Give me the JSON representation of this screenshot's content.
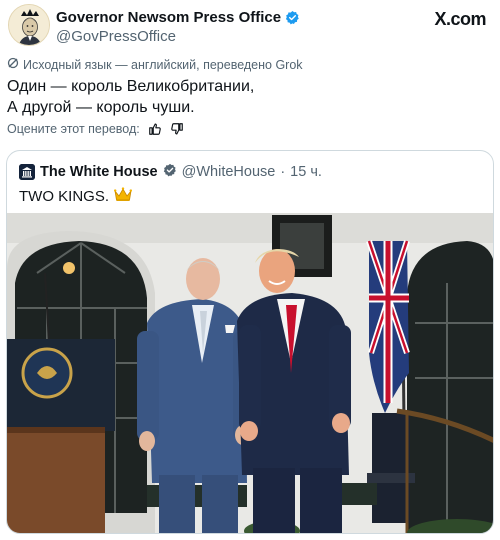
{
  "post": {
    "author_name": "Governor Newsom Press Office",
    "author_handle": "@GovPressOffice",
    "brand": "X.com",
    "translation_note": "Исходный язык — английский, переведено Grok",
    "text_line1": "Один — король Великобритании,",
    "text_line2": "А другой — король чуши.",
    "rate_label": "Оцените этот перевод:"
  },
  "quoted": {
    "author_name": "The White House",
    "author_handle": "@WhiteHouse",
    "separator": "·",
    "time": "15 ч.",
    "text": "TWO KINGS.",
    "emoji": "👑"
  },
  "icons": {
    "verified": "verified-badge-icon",
    "grok": "grok-icon",
    "thumbs_up": "thumbs-up-icon",
    "thumbs_down": "thumbs-down-icon",
    "crown": "crown-icon"
  },
  "colors": {
    "verified_blue": "#1d9bf0",
    "muted_text": "#536471",
    "border": "#cfd9de"
  }
}
